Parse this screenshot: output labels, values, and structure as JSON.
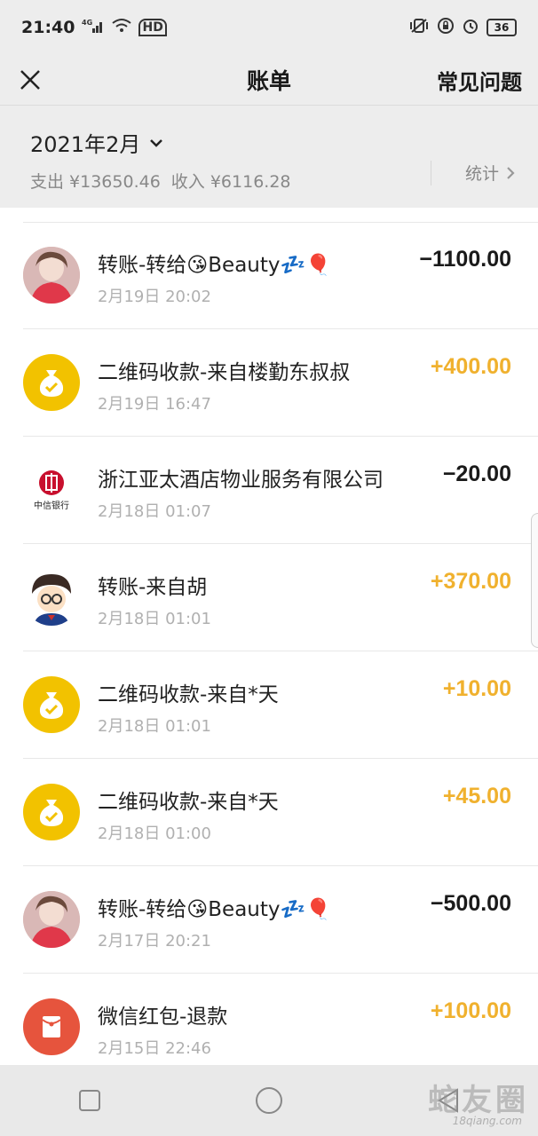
{
  "status_bar": {
    "time": "21:40",
    "network": "4G",
    "hd": "HD",
    "battery": "36"
  },
  "nav": {
    "title": "账单",
    "faq_label": "常见问题"
  },
  "summary": {
    "month": "2021年2月",
    "expense": "支出 ¥13650.46",
    "income": "收入 ¥6116.28",
    "stats_label": "统计"
  },
  "transactions": [
    {
      "title": "转账-转给😘Beauty💤🎈",
      "time": "2月19日 20:02",
      "amount": "−1100.00",
      "direction": "out",
      "avatar": "photo-girl"
    },
    {
      "title": "二维码收款-来自楼勤东叔叔",
      "time": "2月19日 16:47",
      "amount": "+400.00",
      "direction": "in",
      "avatar": "money-bag"
    },
    {
      "title": "浙江亚太酒店物业服务有限公司",
      "time": "2月18日 01:07",
      "amount": "−20.00",
      "direction": "out",
      "avatar": "citic-bank",
      "bank_name": "中信银行"
    },
    {
      "title": "转账-来自胡",
      "time": "2月18日 01:01",
      "amount": "+370.00",
      "direction": "in",
      "avatar": "cartoon-boy"
    },
    {
      "title": "二维码收款-来自*天",
      "time": "2月18日 01:01",
      "amount": "+10.00",
      "direction": "in",
      "avatar": "money-bag"
    },
    {
      "title": "二维码收款-来自*天",
      "time": "2月18日 01:00",
      "amount": "+45.00",
      "direction": "in",
      "avatar": "money-bag"
    },
    {
      "title": "转账-转给😘Beauty💤🎈",
      "time": "2月17日 20:21",
      "amount": "−500.00",
      "direction": "out",
      "avatar": "photo-girl"
    },
    {
      "title": "微信红包-退款",
      "time": "2月15日 22:46",
      "amount": "+100.00",
      "direction": "in",
      "avatar": "red-packet"
    }
  ],
  "colors": {
    "income": "#f0b12e",
    "expense": "#1a1a1a",
    "money_bag_bg": "#f2c200",
    "red_packet_bg": "#e6543d"
  },
  "watermark": {
    "text": "蛇友圈",
    "sub": "18qiang.com"
  }
}
